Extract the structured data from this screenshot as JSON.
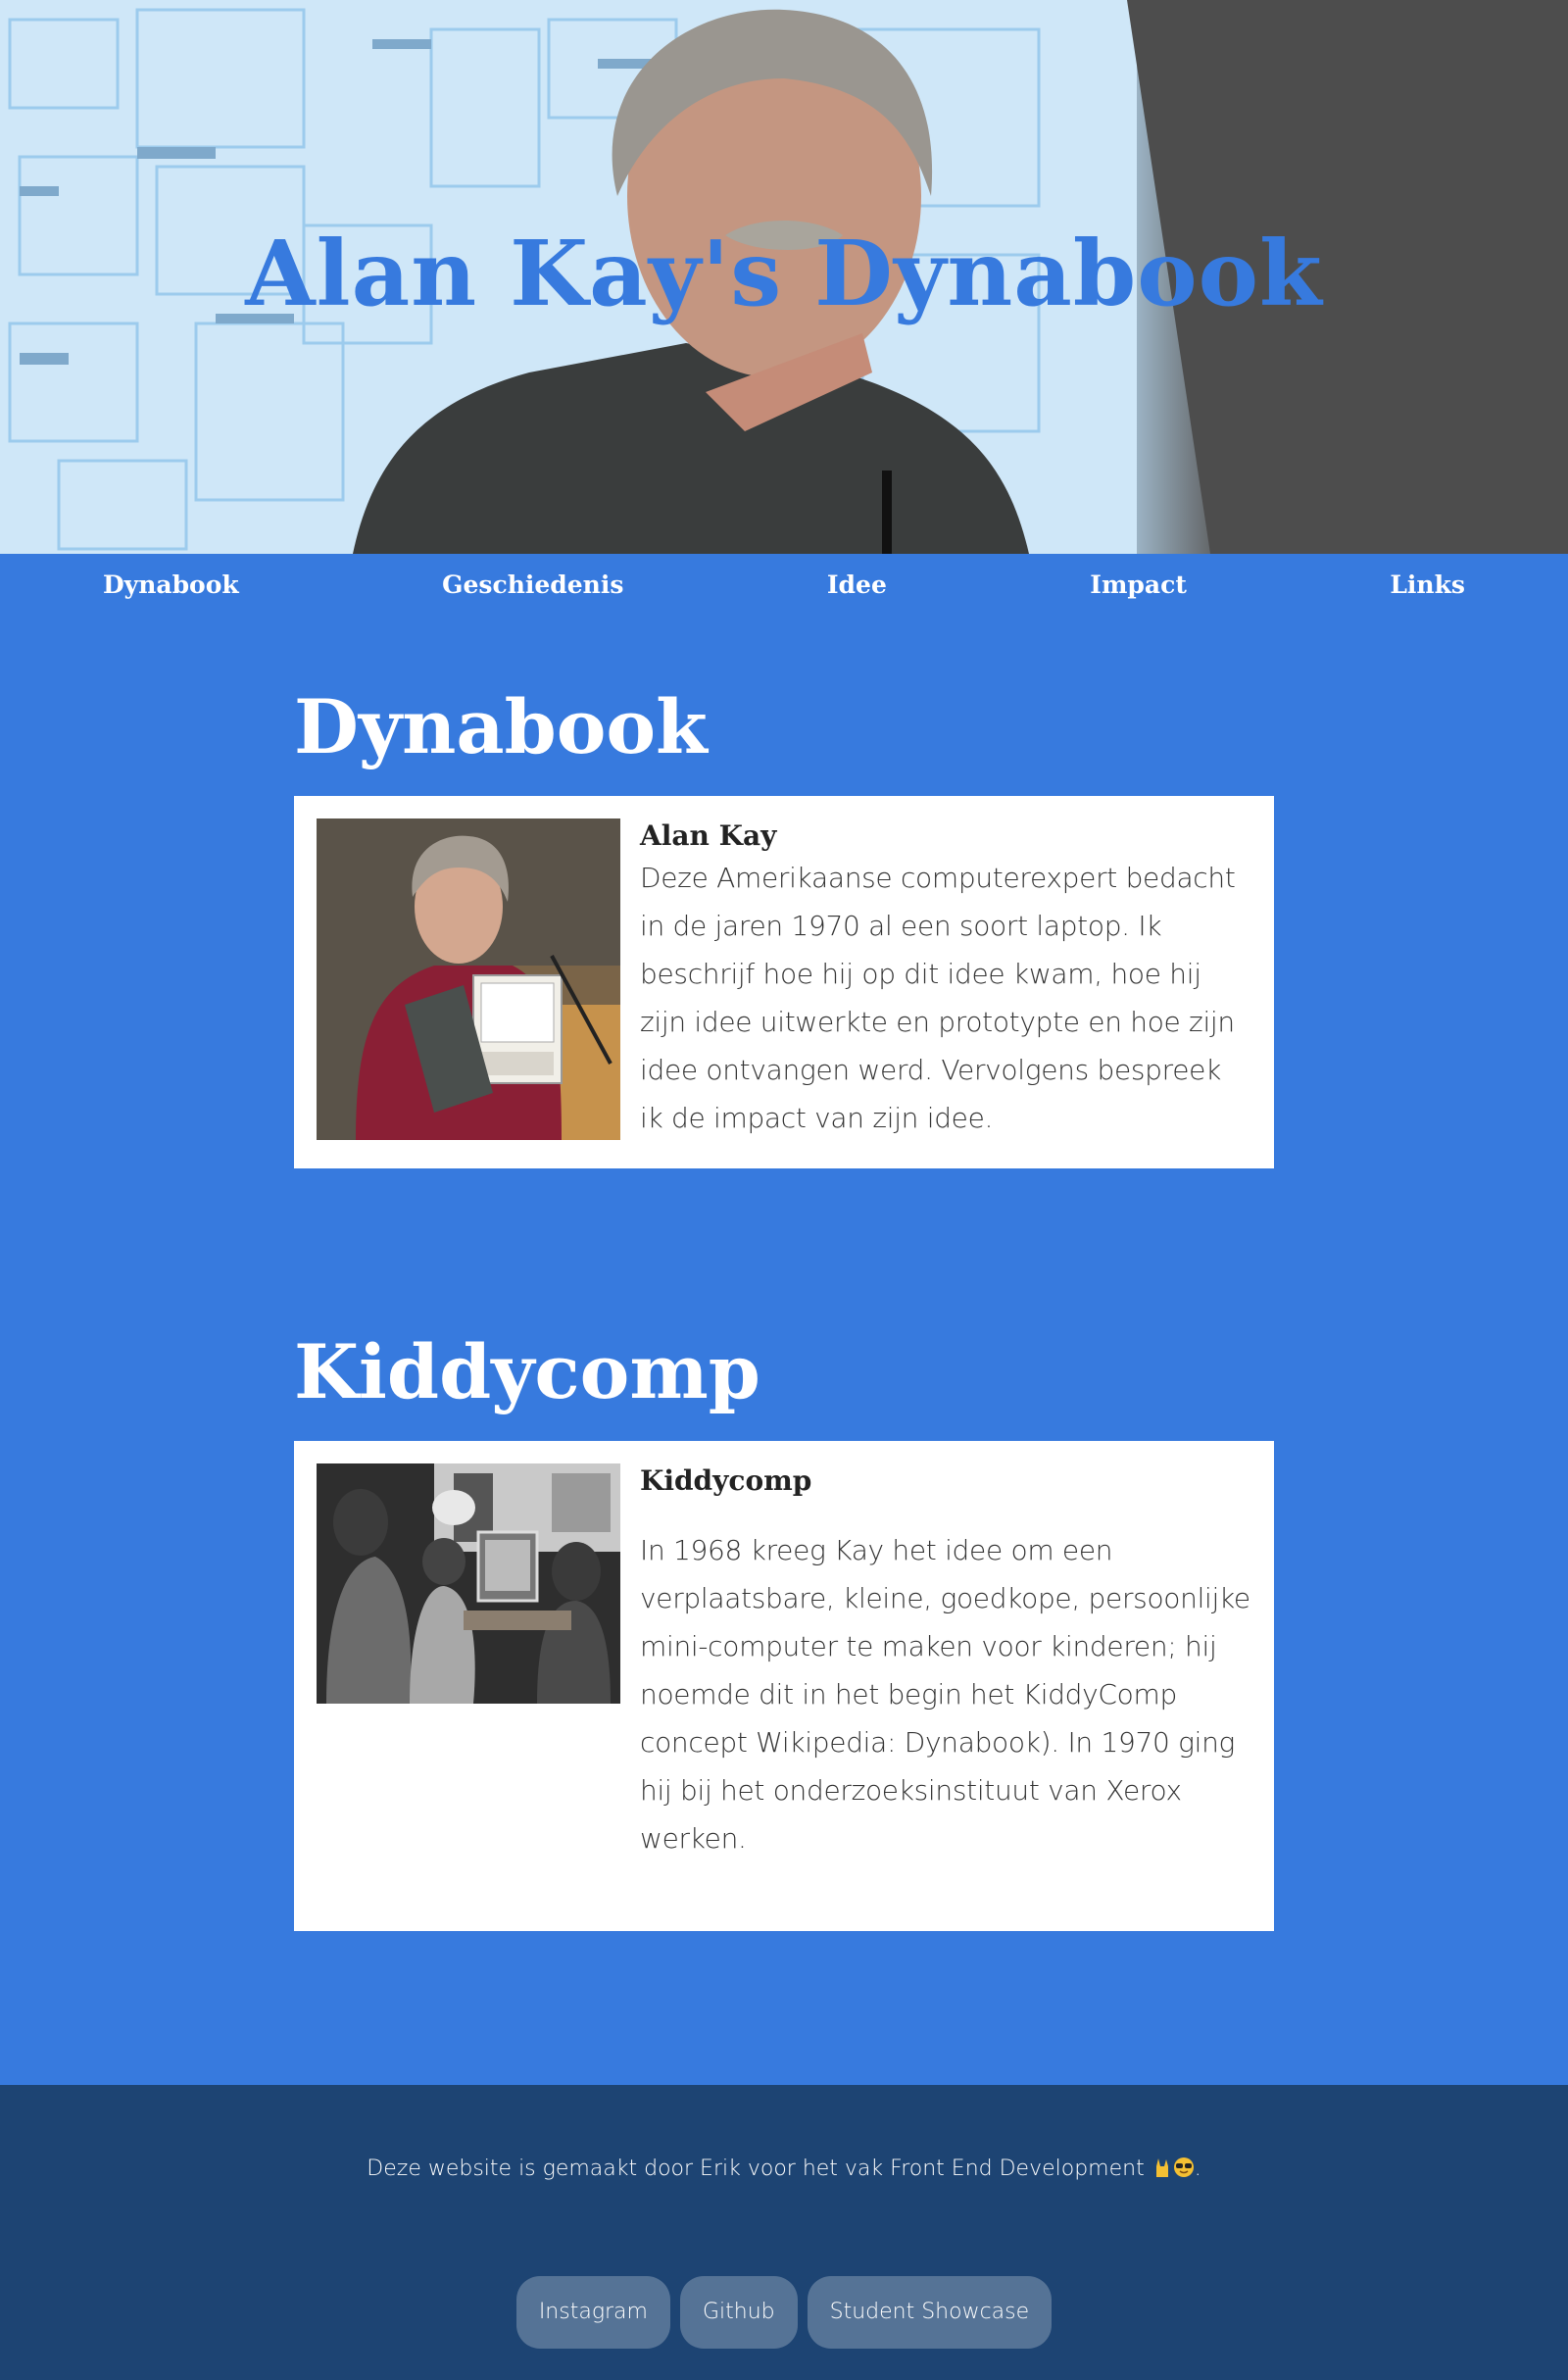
{
  "hero": {
    "title": "Alan Kay's Dynabook"
  },
  "nav": {
    "items": [
      {
        "label": "Dynabook"
      },
      {
        "label": "Geschiedenis"
      },
      {
        "label": "Idee"
      },
      {
        "label": "Impact"
      },
      {
        "label": "Links"
      }
    ]
  },
  "sections": [
    {
      "title": "Dynabook",
      "card_heading": "Alan Kay",
      "card_text": "Deze Amerikaanse computerexpert bedacht in de jaren 1970 al een soort laptop. Ik beschrijf hoe hij op dit idee kwam, hoe hij zijn idee uitwerkte en prototypte en hoe zijn idee ontvangen werd. Vervolgens bespreek ik de impact van zijn idee."
    },
    {
      "title": "Kiddycomp",
      "card_heading": "Kiddycomp",
      "card_text": "In 1968 kreeg Kay het idee om een verplaatsbare, kleine, goedkope, persoonlijke mini-computer te maken voor kinderen; hij noemde dit in het begin het KiddyComp concept Wikipedia: Dynabook). In 1970 ging hij bij het onderzoeksinstituut van Xerox werken."
    }
  ],
  "footer": {
    "text": "Deze website is gemaakt door Erik voor het vak Front End Development",
    "text_end": ".",
    "buttons": [
      {
        "label": "Instagram"
      },
      {
        "label": "Github"
      },
      {
        "label": "Student Showcase"
      }
    ]
  },
  "colors": {
    "primary": "#377ade",
    "footer": "#1d4473",
    "card": "#ffffff"
  }
}
